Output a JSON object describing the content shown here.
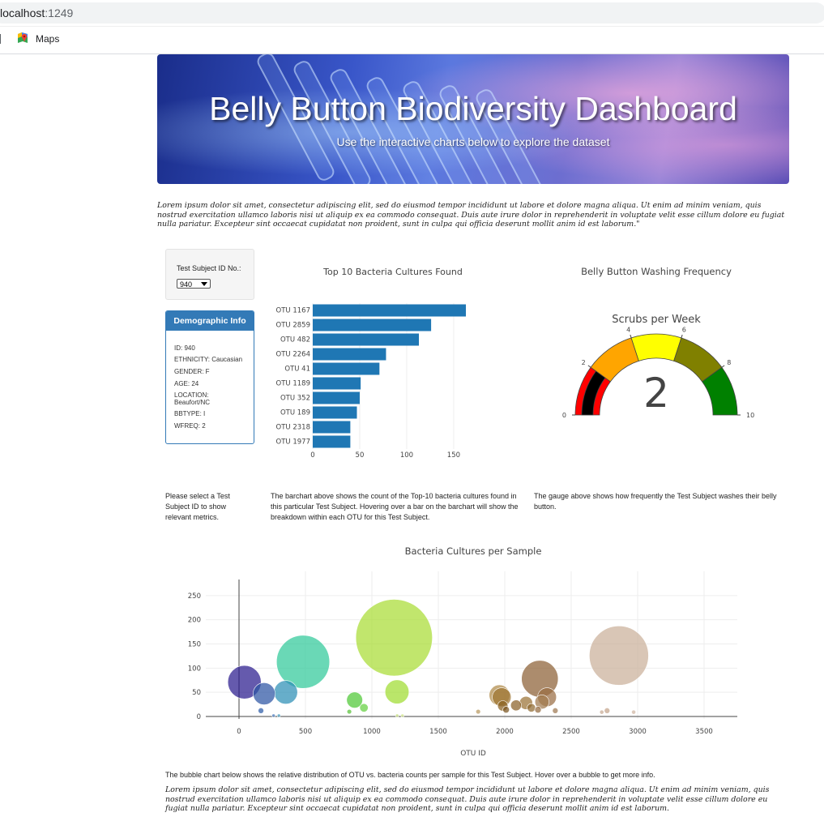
{
  "browser": {
    "url_host": "localhost",
    "url_port": ":1249",
    "bookmark_label": "Maps",
    "maps_icon": "google-maps-pin-icon"
  },
  "hero": {
    "title": "Belly Button Biodiversity Dashboard",
    "subtitle": "Use the interactive charts below to explore the dataset"
  },
  "intro_text": "Lorem ipsum dolor sit amet, consectetur adipiscing elit, sed do eiusmod tempor incididunt ut labore et dolore magna aliqua. Ut enim ad minim veniam, quis nostrud exercitation ullamco laboris nisi ut aliquip ex ea commodo consequat. Duis aute irure dolor in reprehenderit in voluptate velit esse cillum dolore eu fugiat nulla pariatur. Excepteur sint occaecat cupidatat non proident, sunt in culpa qui officia deserunt mollit anim id est laborum.\"",
  "selector": {
    "label": "Test Subject ID No.:",
    "selected": "940"
  },
  "demographics": {
    "header": "Demographic Info",
    "lines": [
      "ID: 940",
      "ETHNICITY: Caucasian",
      "GENDER: F",
      "AGE: 24",
      "LOCATION: Beaufort/NC",
      "BBTYPE: I",
      "WFREQ: 2"
    ]
  },
  "captions": {
    "select": "Please select a Test Subject ID to show relevant metrics.",
    "bar": "The barchart above shows the count of the Top-10 bacteria cultures found in this particular Test Subject. Hovering over a bar on the barchart will show the breakdown within each OTU for this Test Subject.",
    "gauge": "The gauge above shows how frequently the Test Subject washes their belly button.",
    "bubble": "The bubble chart below shows the relative distribution of OTU vs. bacteria counts per sample for this Test Subject. Hover over a bubble to get more info."
  },
  "outro_text": "Lorem ipsum dolor sit amet, consectetur adipiscing elit, sed do eiusmod tempor incididunt ut labore et dolore magna aliqua. Ut enim ad minim veniam, quis nostrud exercitation ullamco laboris nisi ut aliquip ex ea commodo consequat. Duis aute irure dolor in reprehenderit in voluptate velit esse cillum dolore eu fugiat nulla pariatur. Excepteur sint occaecat cupidatat non proident, sunt in culpa qui officia deserunt mollit anim id est laborum.",
  "chart_data": [
    {
      "type": "bar",
      "orientation": "horizontal",
      "title": "Top 10 Bacteria Cultures Found",
      "categories": [
        "OTU 1167",
        "OTU 2859",
        "OTU 482",
        "OTU 2264",
        "OTU 41",
        "OTU 1189",
        "OTU 352",
        "OTU 189",
        "OTU 2318",
        "OTU 1977"
      ],
      "values": [
        163,
        126,
        113,
        78,
        71,
        51,
        50,
        47,
        40,
        40
      ],
      "xlim": [
        0,
        163
      ],
      "xticks": [
        0,
        50,
        100,
        150
      ],
      "color": "#1f77b4",
      "grid": true
    },
    {
      "type": "gauge",
      "title": "Belly Button Washing Frequency",
      "gauge_title": "Scrubs per Week",
      "value": 2,
      "range": [
        0,
        10
      ],
      "ticks": [
        0,
        2,
        4,
        6,
        8,
        10
      ],
      "steps": [
        {
          "range": [
            0,
            2
          ],
          "color": "#ff0000"
        },
        {
          "range": [
            2,
            4
          ],
          "color": "#ffa500"
        },
        {
          "range": [
            4,
            6
          ],
          "color": "#ffff00"
        },
        {
          "range": [
            6,
            8
          ],
          "color": "#808000"
        },
        {
          "range": [
            8,
            10
          ],
          "color": "#008000"
        }
      ],
      "bar_color": "#000000"
    },
    {
      "type": "scatter",
      "mode": "bubble",
      "title": "Bacteria Cultures per Sample",
      "xlabel": "OTU ID",
      "ylabel": "",
      "xlim": [
        -250,
        3750
      ],
      "ylim": [
        -5,
        300
      ],
      "xticks": [
        0,
        500,
        1000,
        1500,
        2000,
        2500,
        3000,
        3500
      ],
      "yticks": [
        0,
        50,
        100,
        150,
        200,
        250
      ],
      "grid": true,
      "points": [
        {
          "x": 41,
          "y": 71,
          "color": "#2a1a8e"
        },
        {
          "x": 189,
          "y": 47,
          "color": "#2d55a4"
        },
        {
          "x": 165,
          "y": 12,
          "color": "#2d5ba8"
        },
        {
          "x": 352,
          "y": 50,
          "color": "#2c8fb6"
        },
        {
          "x": 482,
          "y": 113,
          "color": "#30c99a"
        },
        {
          "x": 1167,
          "y": 163,
          "color": "#a9dd35"
        },
        {
          "x": 1189,
          "y": 51,
          "color": "#a0dc30"
        },
        {
          "x": 870,
          "y": 34,
          "color": "#4dc735"
        },
        {
          "x": 940,
          "y": 18,
          "color": "#64d040"
        },
        {
          "x": 830,
          "y": 10,
          "color": "#58c038"
        },
        {
          "x": 1960,
          "y": 44,
          "color": "#b08a4a"
        },
        {
          "x": 1977,
          "y": 40,
          "color": "#9e7432"
        },
        {
          "x": 1985,
          "y": 22,
          "color": "#8a6324"
        },
        {
          "x": 2010,
          "y": 14,
          "color": "#7a5520"
        },
        {
          "x": 2085,
          "y": 23,
          "color": "#8b6128"
        },
        {
          "x": 2160,
          "y": 28,
          "color": "#9a7235"
        },
        {
          "x": 2200,
          "y": 18,
          "color": "#8f6a31"
        },
        {
          "x": 2264,
          "y": 78,
          "color": "#8c5f34"
        },
        {
          "x": 2280,
          "y": 30,
          "color": "#a17a4e"
        },
        {
          "x": 2318,
          "y": 40,
          "color": "#9a6e44"
        },
        {
          "x": 2250,
          "y": 14,
          "color": "#946b40"
        },
        {
          "x": 2380,
          "y": 12,
          "color": "#9e7952"
        },
        {
          "x": 1800,
          "y": 10,
          "color": "#b89860"
        },
        {
          "x": 2859,
          "y": 126,
          "color": "#cbb09a"
        },
        {
          "x": 2770,
          "y": 12,
          "color": "#c4a48a"
        },
        {
          "x": 2730,
          "y": 9,
          "color": "#c8ab94"
        },
        {
          "x": 2970,
          "y": 9,
          "color": "#d0b6a2"
        },
        {
          "x": 1190,
          "y": 2,
          "color": "#c8e080"
        },
        {
          "x": 1230,
          "y": 2,
          "color": "#d4e890"
        },
        {
          "x": 260,
          "y": 2,
          "color": "#5080c0"
        },
        {
          "x": 300,
          "y": 2,
          "color": "#4aa0c0"
        }
      ]
    }
  ]
}
